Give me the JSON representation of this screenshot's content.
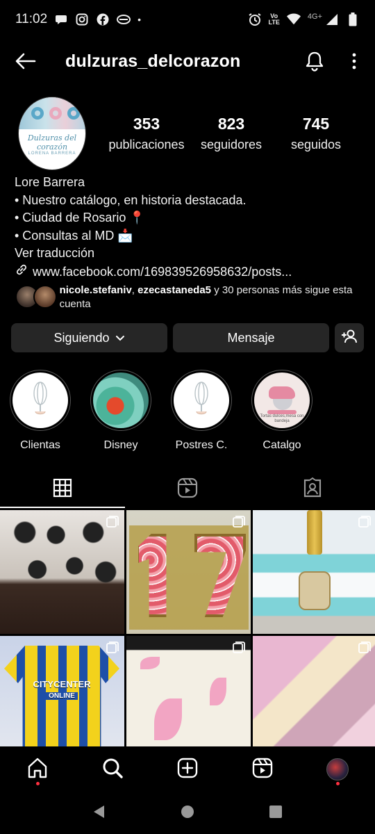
{
  "status_bar": {
    "time": "11:02",
    "network_label": "4G+",
    "volte_label": "Vo\nLTE"
  },
  "header": {
    "username": "dulzuras_delcorazon"
  },
  "profile": {
    "avatar_brand": "Dulzuras del corazón",
    "avatar_sub": "LORENA BARRERA",
    "stats": [
      {
        "value": "353",
        "label": "publicaciones"
      },
      {
        "value": "823",
        "label": "seguidores"
      },
      {
        "value": "745",
        "label": "seguidos"
      }
    ]
  },
  "bio": {
    "name": "Lore Barrera",
    "line1": "• Nuestro catálogo, en historia destacada.",
    "line2": "• Ciudad de Rosario 📍",
    "line3": "• Consultas al MD 📩",
    "translate": "Ver traducción",
    "link": "www.facebook.com/169839526958632/posts..."
  },
  "followed_by": {
    "user1": "nicole.stefaniv",
    "separator": ", ",
    "user2": "ezecastaneda5",
    "rest": " y 30 personas más sigue esta cuenta"
  },
  "buttons": {
    "following": "Siguiendo",
    "message": "Mensaje"
  },
  "highlights": [
    {
      "label": "Clientas"
    },
    {
      "label": "Disney"
    },
    {
      "label": "Postres C."
    },
    {
      "label": "Catalgo"
    }
  ],
  "highlight_catalog_caption": "Tortas dulces,mesa\ncon bandeja",
  "grid": {
    "jersey_sponsor": "CITYCENTER",
    "jersey_sponsor2": "ONLINE"
  },
  "colors": {
    "background": "#000000",
    "button_bg": "#262626",
    "notification_dot": "#ff3040"
  },
  "icons": [
    "back-arrow-icon",
    "bell-icon",
    "more-vertical-icon",
    "chevron-down-icon",
    "add-user-icon",
    "grid-icon",
    "reels-icon",
    "tagged-icon",
    "home-icon",
    "search-icon",
    "create-icon",
    "reels-nav-icon",
    "profile-avatar"
  ]
}
